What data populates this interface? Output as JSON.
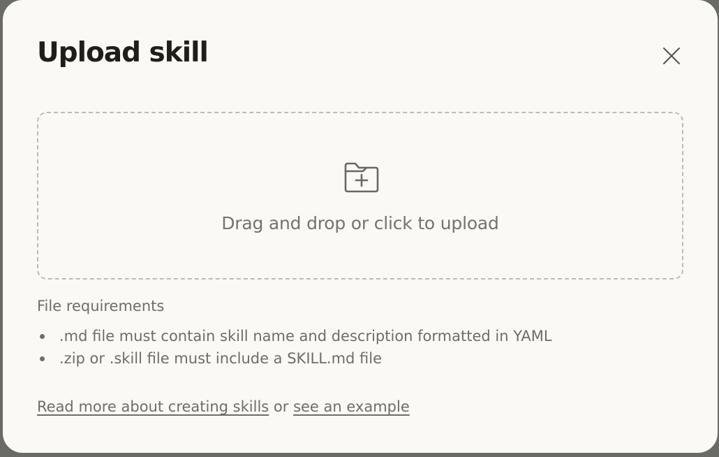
{
  "dialog": {
    "title": "Upload skill",
    "close_icon": "close-icon"
  },
  "dropzone": {
    "icon": "folder-plus-icon",
    "text": "Drag and drop or click to upload"
  },
  "requirements": {
    "heading": "File requirements",
    "items": [
      ".md file must contain skill name and description formatted in YAML",
      ".zip or .skill file must include a SKILL.md file"
    ]
  },
  "footer": {
    "link_1": "Read more about creating skills",
    "connector": " or ",
    "link_2": "see an example"
  },
  "colors": {
    "modal_bg": "#faf9f5",
    "title": "#1f1e1b",
    "muted_text": "#6f6d66",
    "dashed_border": "#bdbbb3"
  }
}
